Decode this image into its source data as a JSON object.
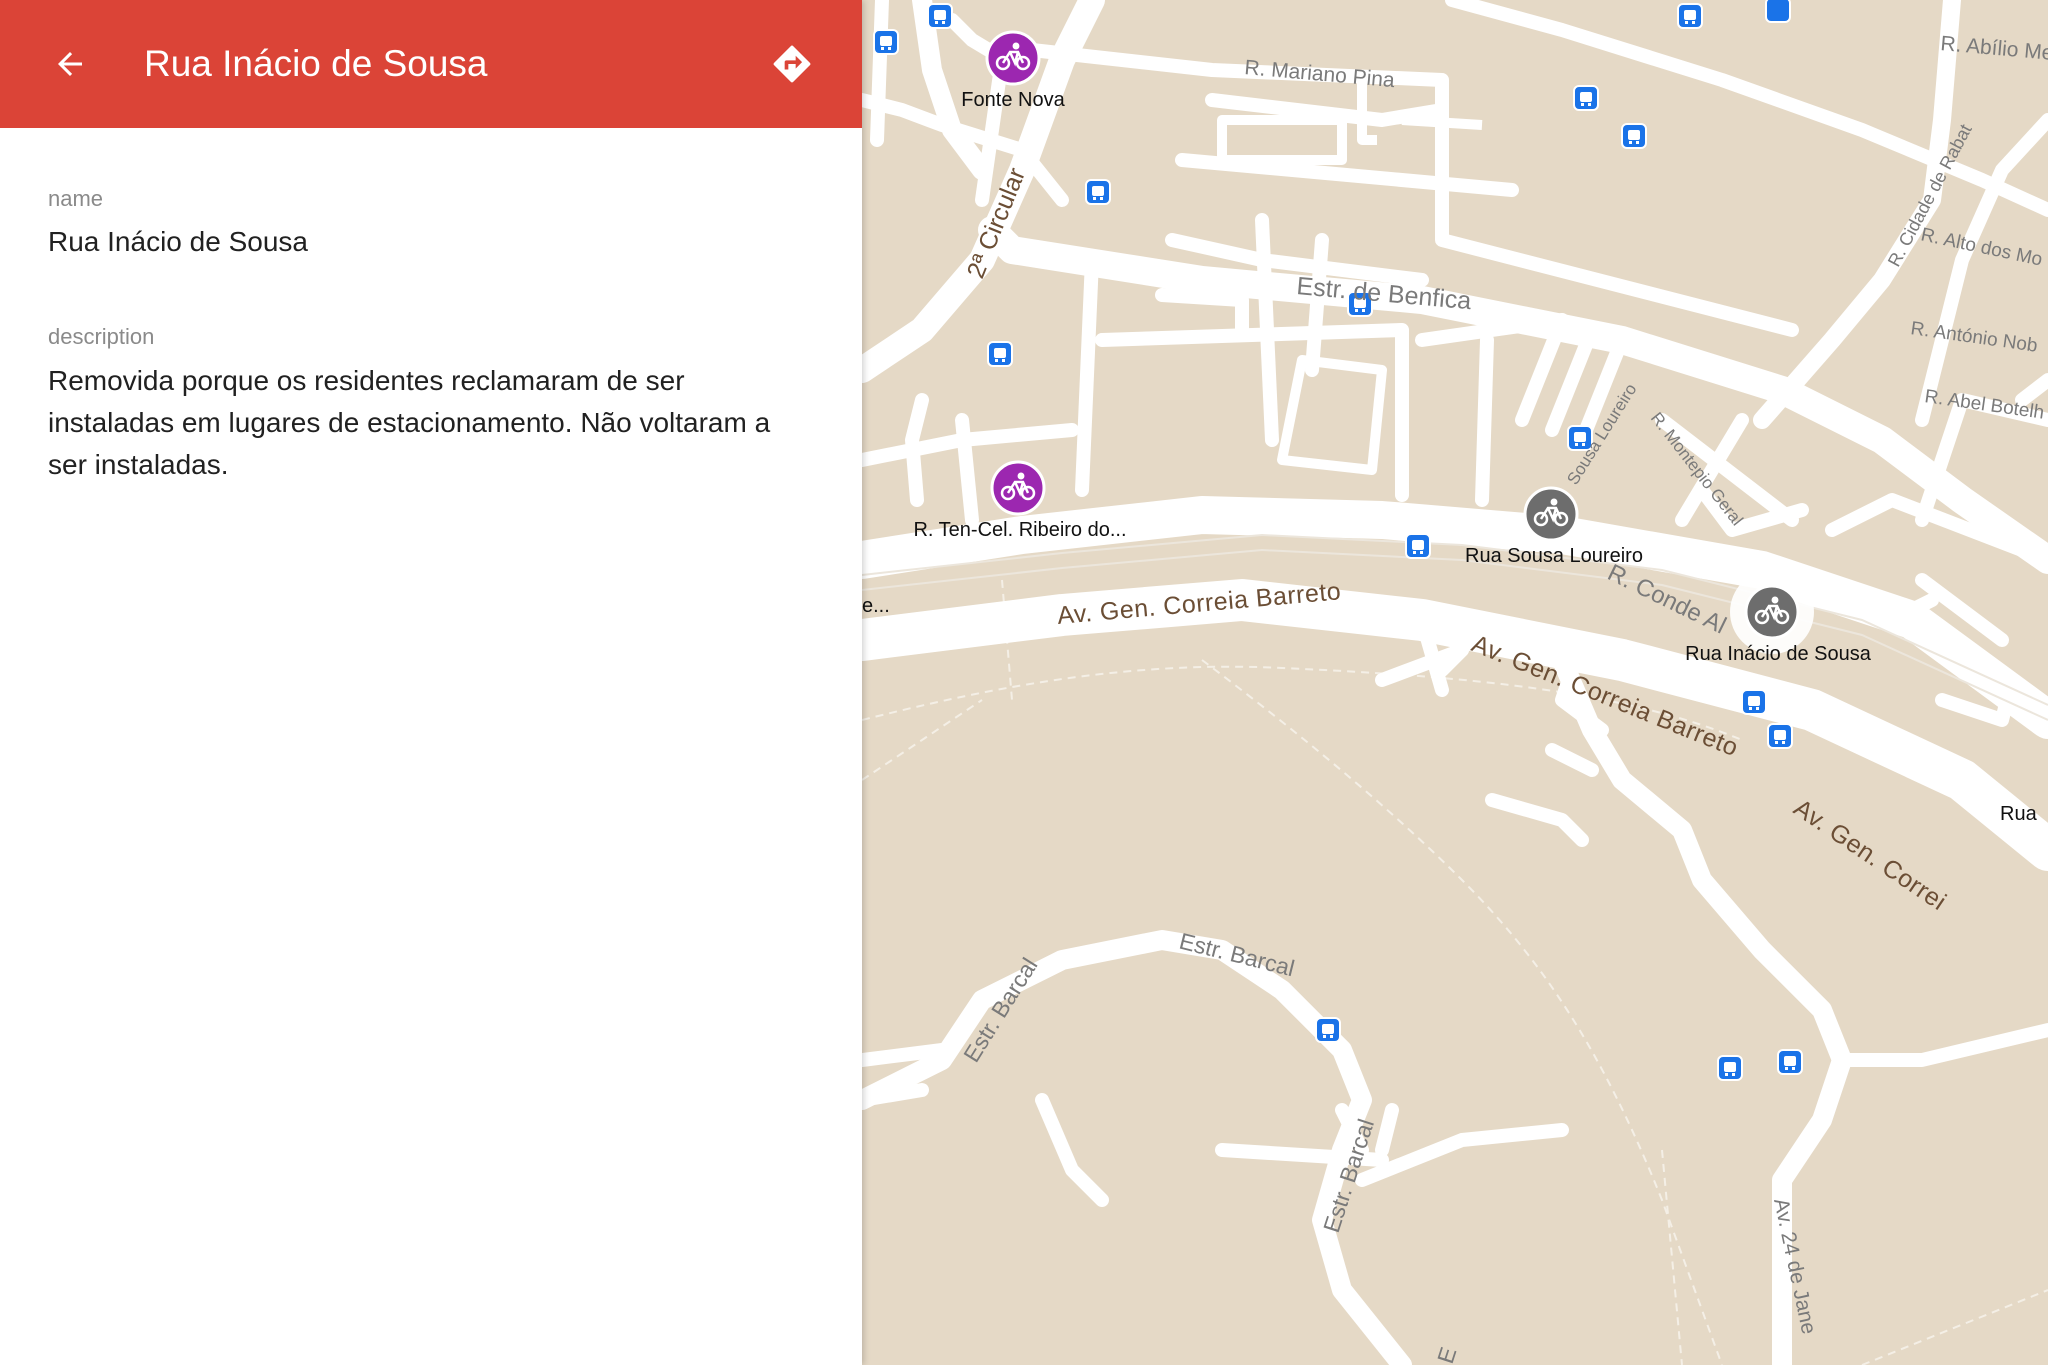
{
  "panel": {
    "title": "Rua Inácio de Sousa",
    "back_icon": "arrow-left-icon",
    "directions_icon": "directions-icon",
    "fields": {
      "name_label": "name",
      "name_value": "Rua Inácio de Sousa",
      "description_label": "description",
      "description_value": "Removida porque os residentes reclamaram de ser instaladas em lugares de estacionamento. Não voltaram a ser instaladas."
    }
  },
  "map": {
    "colors": {
      "land": "#e5d9c6",
      "road": "#ffffff",
      "header": "#db4437",
      "marker_active": "#9c27b0",
      "marker_removed": "#6d6d6d",
      "bus": "#1a73e8"
    },
    "markers": [
      {
        "label": "Fonte Nova",
        "status": "active",
        "icon": "bicycle-icon"
      },
      {
        "label": "R. Ten-Cel. Ribeiro do...",
        "status": "active",
        "icon": "bicycle-icon"
      },
      {
        "label": "Rua Sousa Loureiro",
        "status": "removed",
        "icon": "bicycle-icon"
      },
      {
        "label": "Rua Inácio de Sousa",
        "status": "removed",
        "selected": true,
        "icon": "bicycle-icon"
      }
    ],
    "street_labels": {
      "mariano_pina": "R. Mariano Pina",
      "abilio": "R. Abílio Me",
      "circular": "2ª Circular",
      "benfica": "Estr. de Benfica",
      "rabat": "R. Cidade de Rabat",
      "alto_moinho": "R. Alto dos Mo",
      "antonio_nob": "R. António Nob",
      "abel": "R. Abel Botelh",
      "sousa_loureiro": "Sousa Loureiro",
      "montepio": "R. Montepio Geral",
      "conde": "R. Conde Al",
      "correia_1": "Av. Gen. Correia Barreto",
      "correia_2": "Av. Gen. Correia Barreto",
      "correia_3": "Av. Gen. Correi",
      "edge_left": "e...",
      "rua_edge": "Rua ",
      "barcal_1": "Estr. Barcal",
      "barcal_2": "Estr. Barcal",
      "barcal_3": "Estr. Barcal",
      "av24": "Av. 24 de Jane",
      "bottom_e": "E"
    }
  }
}
